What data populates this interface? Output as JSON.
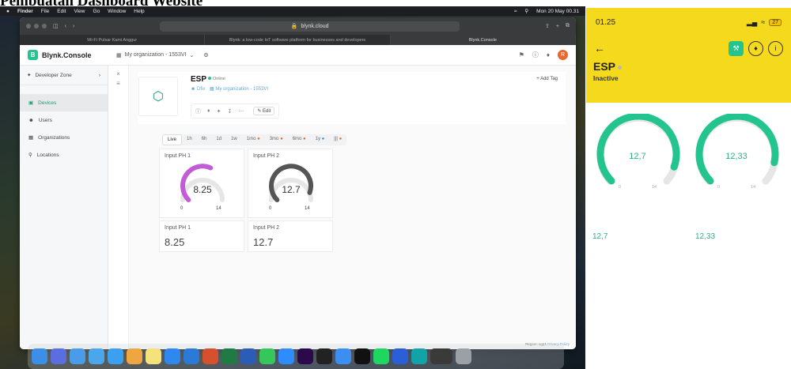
{
  "heading": "Pembuatan Dashboard Website",
  "menubar": {
    "apple": "",
    "items": [
      "Finder",
      "File",
      "Edit",
      "View",
      "Go",
      "Window",
      "Help"
    ],
    "datetime": "Mon 20 May 00.31"
  },
  "browser": {
    "url": "blynk.cloud",
    "tabs": [
      "Wi-Fi Pulsar Kami Anggur",
      "Blynk: a low-code IoT software platform for businesses and developers",
      "Blynk.Console"
    ]
  },
  "console": {
    "logo": "Blynk.Console",
    "org_selector": "My organization - 1553VI",
    "avatar_initial": "R",
    "sidebar": {
      "developer_zone": "Developer Zone",
      "items": [
        "Devices",
        "Users",
        "Organizations",
        "Locations"
      ],
      "active": "Devices"
    },
    "device": {
      "name": "ESP",
      "status": "Online",
      "owner": "Dfix",
      "organization": "My organization - 1553VI",
      "edit_label": "Edit",
      "add_tag_label": "+ Add Tag"
    },
    "time_ranges": [
      "Live",
      "1h",
      "6h",
      "1d",
      "1w",
      "1mo",
      "3mo",
      "6mo",
      "1y",
      "|||"
    ],
    "active_range": "Live",
    "gauges": [
      {
        "title": "Input PH 1",
        "value": "8.25",
        "min": "0",
        "max": "14",
        "color": "#c45bd6",
        "fraction": 0.589
      },
      {
        "title": "Input PH 2",
        "value": "12.7",
        "min": "0",
        "max": "14",
        "color": "#555555",
        "fraction": 0.907
      }
    ],
    "labels": [
      {
        "title": "Input PH 1",
        "value": "8.25"
      },
      {
        "title": "Input PH 2",
        "value": "12.7"
      }
    ],
    "region_text": "Region: sgp1",
    "privacy_link": "Privacy Policy"
  },
  "phone": {
    "time": "01.25",
    "battery": "27",
    "device_name": "ESP",
    "device_state": "Inactive",
    "accent": "#f5d91c",
    "gauges": [
      {
        "value": "12,7",
        "min": "0",
        "max": "14",
        "fraction": 0.907
      },
      {
        "value": "12,33",
        "min": "0",
        "max": "14",
        "fraction": 0.881
      }
    ],
    "labels": [
      "12,7",
      "12,33"
    ]
  }
}
